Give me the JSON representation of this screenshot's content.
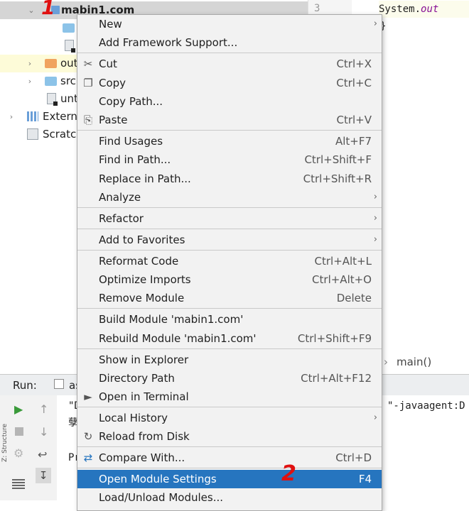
{
  "tree": {
    "root_label": "mabin1.com",
    "out_label": "out",
    "src_label": "src",
    "untitled_label": "unt",
    "external_label": "External",
    "scratch_label": "Scratch"
  },
  "editor": {
    "line_number": "3",
    "code_line_1": "System.",
    "code_line_1_italic": "out",
    "code_line_2": "}",
    "breadcrumb": "main()"
  },
  "run": {
    "title": "Run:",
    "tab_label": "as",
    "console_line_1": "\"D",
    "console_line_1_right": "\"-javaagent:D",
    "console_line_2": "孽",
    "console_line_3": "Pr",
    "side_label": "Z: Structure"
  },
  "menu": {
    "items": [
      {
        "label": "New",
        "shortcut": "",
        "submenu": true,
        "icon": ""
      },
      {
        "label": "Add Framework Support...",
        "shortcut": "",
        "submenu": false,
        "icon": ""
      },
      {
        "label": "Cut",
        "shortcut": "Ctrl+X",
        "submenu": false,
        "icon": "✂"
      },
      {
        "label": "Copy",
        "shortcut": "Ctrl+C",
        "submenu": false,
        "icon": "❐"
      },
      {
        "label": "Copy Path...",
        "shortcut": "",
        "submenu": false,
        "icon": ""
      },
      {
        "label": "Paste",
        "shortcut": "Ctrl+V",
        "submenu": false,
        "icon": "⎘"
      },
      {
        "label": "Find Usages",
        "shortcut": "Alt+F7",
        "submenu": false,
        "icon": ""
      },
      {
        "label": "Find in Path...",
        "shortcut": "Ctrl+Shift+F",
        "submenu": false,
        "icon": ""
      },
      {
        "label": "Replace in Path...",
        "shortcut": "Ctrl+Shift+R",
        "submenu": false,
        "icon": ""
      },
      {
        "label": "Analyze",
        "shortcut": "",
        "submenu": true,
        "icon": ""
      },
      {
        "label": "Refactor",
        "shortcut": "",
        "submenu": true,
        "icon": ""
      },
      {
        "label": "Add to Favorites",
        "shortcut": "",
        "submenu": true,
        "icon": ""
      },
      {
        "label": "Reformat Code",
        "shortcut": "Ctrl+Alt+L",
        "submenu": false,
        "icon": ""
      },
      {
        "label": "Optimize Imports",
        "shortcut": "Ctrl+Alt+O",
        "submenu": false,
        "icon": ""
      },
      {
        "label": "Remove Module",
        "shortcut": "Delete",
        "submenu": false,
        "icon": ""
      },
      {
        "label": "Build Module 'mabin1.com'",
        "shortcut": "",
        "submenu": false,
        "icon": ""
      },
      {
        "label": "Rebuild Module 'mabin1.com'",
        "shortcut": "Ctrl+Shift+F9",
        "submenu": false,
        "icon": ""
      },
      {
        "label": "Show in Explorer",
        "shortcut": "",
        "submenu": false,
        "icon": ""
      },
      {
        "label": "Directory Path",
        "shortcut": "Ctrl+Alt+F12",
        "submenu": false,
        "icon": ""
      },
      {
        "label": "Open in Terminal",
        "shortcut": "",
        "submenu": false,
        "icon": "►"
      },
      {
        "label": "Local History",
        "shortcut": "",
        "submenu": true,
        "icon": ""
      },
      {
        "label": "Reload from Disk",
        "shortcut": "",
        "submenu": false,
        "icon": "↻"
      },
      {
        "label": "Compare With...",
        "shortcut": "Ctrl+D",
        "submenu": false,
        "icon": "⇄"
      },
      {
        "label": "Open Module Settings",
        "shortcut": "F4",
        "submenu": false,
        "icon": ""
      },
      {
        "label": "Load/Unload Modules...",
        "shortcut": "",
        "submenu": false,
        "icon": ""
      }
    ]
  },
  "annotations": {
    "mark_1": "1",
    "mark_2": "2"
  },
  "colors": {
    "selection": "#2675bf",
    "annotation": "#e01010",
    "folder_blue": "#8cc3e8",
    "folder_orange": "#f0a35e"
  }
}
